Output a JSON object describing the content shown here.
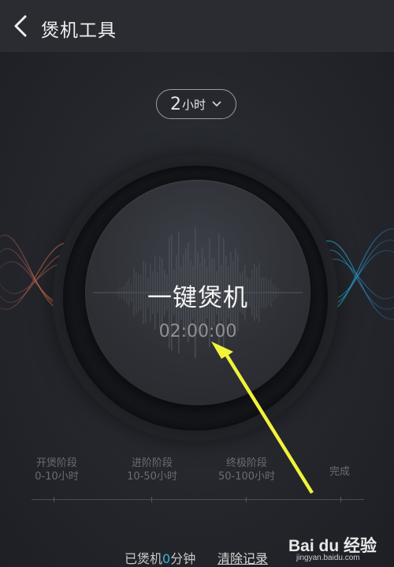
{
  "header": {
    "title": "煲机工具",
    "back_icon": "chevron-left-icon"
  },
  "duration": {
    "number": "2",
    "unit": "小时",
    "dropdown_icon": "chevron-down-icon"
  },
  "main_button": {
    "label": "一键煲机",
    "timer": "02:00:00"
  },
  "stages": [
    {
      "name": "开煲阶段",
      "range": "0-10小时"
    },
    {
      "name": "进阶阶段",
      "range": "10-50小时"
    },
    {
      "name": "终极阶段",
      "range": "50-100小时"
    },
    {
      "name": "完成",
      "range": ""
    }
  ],
  "footer": {
    "burned_prefix": "已煲机",
    "burned_value": "0",
    "burned_suffix": "分钟",
    "clear_label": "清除记录"
  },
  "watermark": {
    "brand": "Bai du 经验",
    "url": "jingyan.baidu.com"
  },
  "colors": {
    "accent": "#2fb8e0",
    "arrow": "#f2f23a",
    "wave_left": "#e0704a",
    "wave_right": "#2ec3d6"
  }
}
